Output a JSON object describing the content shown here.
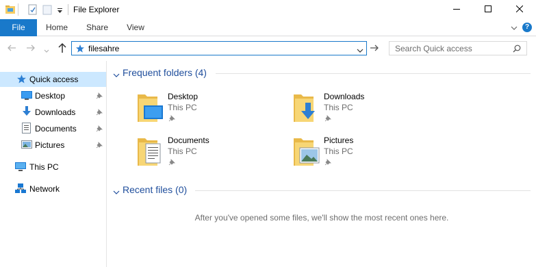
{
  "window": {
    "title": "File Explorer",
    "controls": {
      "minimize": "minimize",
      "maximize": "maximize",
      "close": "close"
    }
  },
  "quick_access_toolbar": {
    "icons": [
      "folder-app-icon",
      "properties-icon",
      "new-folder-icon",
      "customize-dropdown-icon"
    ]
  },
  "ribbon": {
    "tabs": [
      {
        "label": "File",
        "active": true
      },
      {
        "label": "Home"
      },
      {
        "label": "Share"
      },
      {
        "label": "View"
      }
    ],
    "help_label": "?"
  },
  "address": {
    "value": "filesahre",
    "icon": "quick-access-star-icon"
  },
  "search": {
    "placeholder": "Search Quick access"
  },
  "nav_pane": {
    "items": [
      {
        "label": "Quick access",
        "icon": "quick-access-star-icon",
        "selected": true
      },
      {
        "label": "Desktop",
        "icon": "desktop-icon",
        "pinned": true
      },
      {
        "label": "Downloads",
        "icon": "downloads-icon",
        "pinned": true
      },
      {
        "label": "Documents",
        "icon": "documents-icon",
        "pinned": true
      },
      {
        "label": "Pictures",
        "icon": "pictures-icon",
        "pinned": true
      },
      {
        "label": "This PC",
        "icon": "this-pc-icon"
      },
      {
        "label": "Network",
        "icon": "network-icon"
      }
    ]
  },
  "content": {
    "frequent_header": "Frequent folders (4)",
    "frequent_folders": [
      {
        "name": "Desktop",
        "location": "This PC",
        "icon": "desktop-folder-icon"
      },
      {
        "name": "Downloads",
        "location": "This PC",
        "icon": "downloads-folder-icon"
      },
      {
        "name": "Documents",
        "location": "This PC",
        "icon": "documents-folder-icon"
      },
      {
        "name": "Pictures",
        "location": "This PC",
        "icon": "pictures-folder-icon"
      }
    ],
    "recent_header": "Recent files (0)",
    "recent_empty_message": "After you've opened some files, we'll show the most recent ones here."
  },
  "colors": {
    "accent": "#1979ca",
    "folder": "#f5cc63",
    "header_text": "#1f4e9c"
  }
}
